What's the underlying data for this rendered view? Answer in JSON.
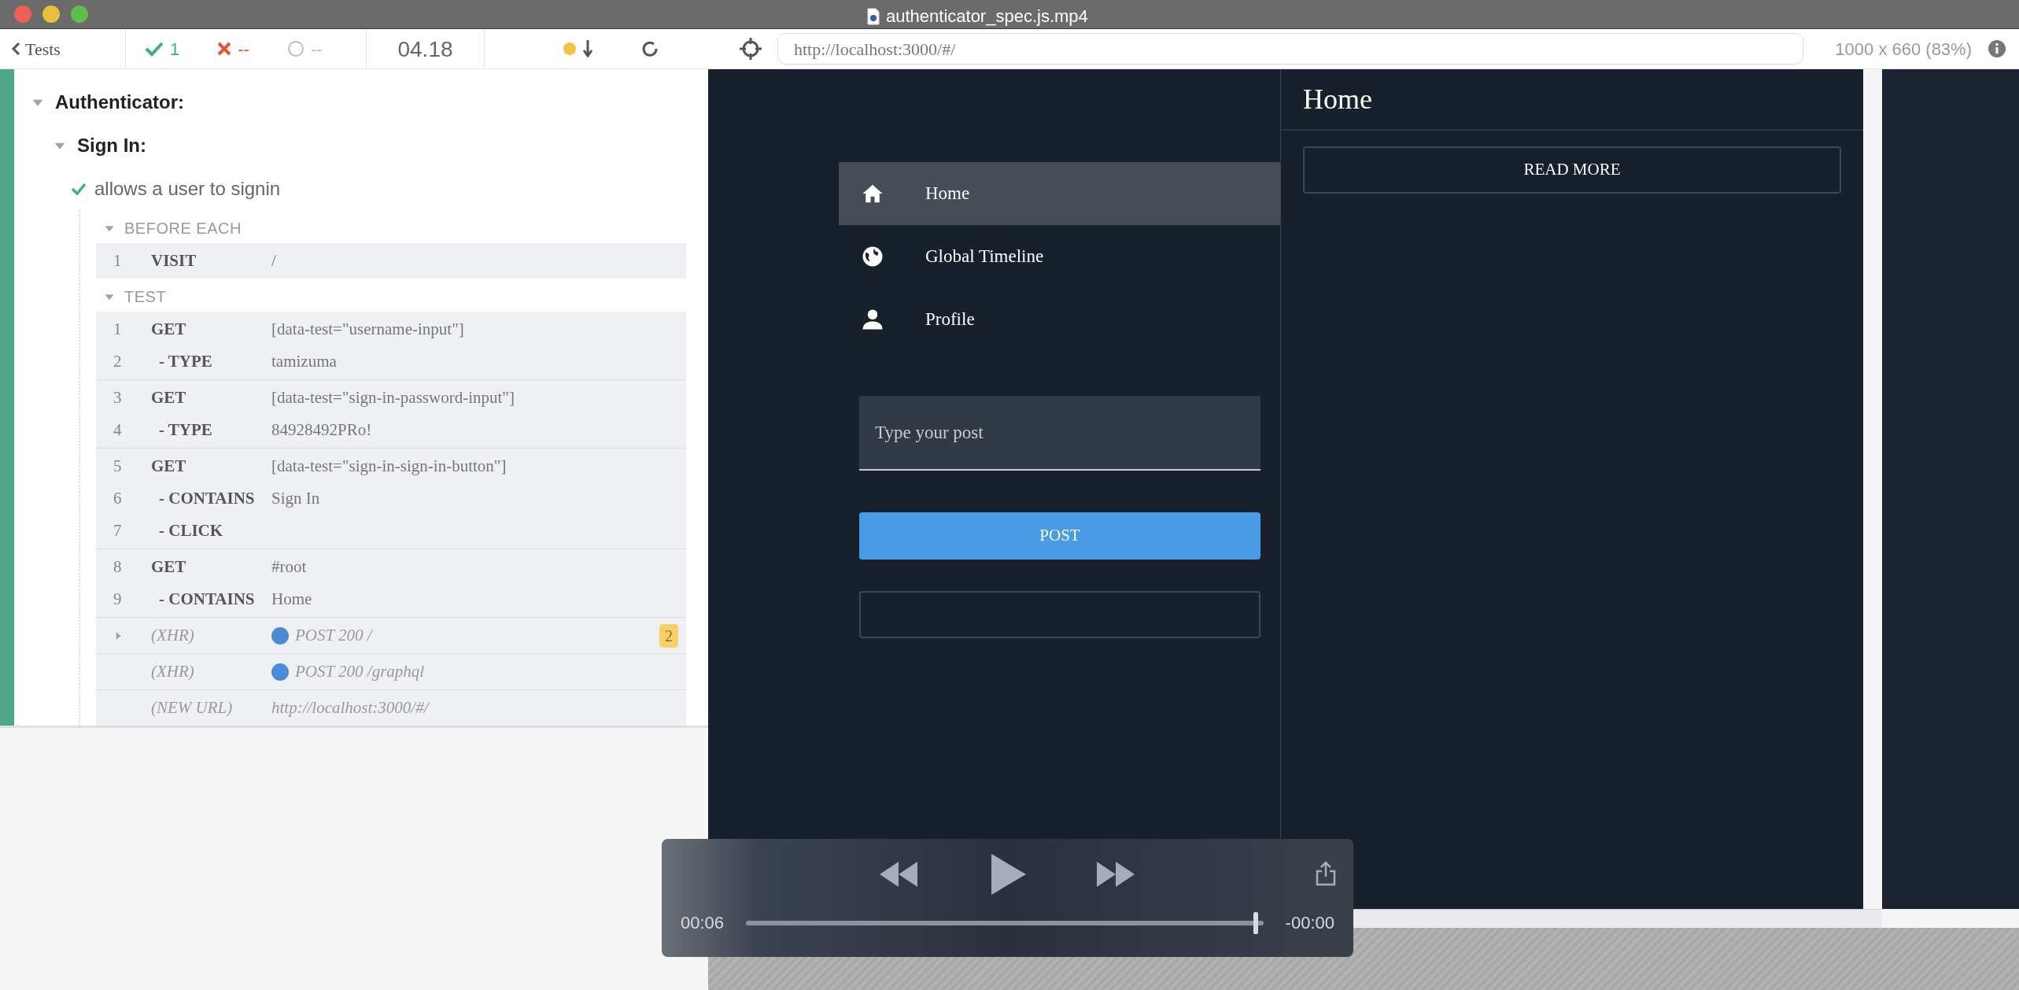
{
  "window": {
    "title": "authenticator_spec.js.mp4"
  },
  "toolbar": {
    "back_label": "Tests",
    "passed": "1",
    "failed": "--",
    "pending": "--",
    "duration": "04.18",
    "url": "http://localhost:3000/#/",
    "viewport": "1000 x 660 (83%)"
  },
  "suite": {
    "title": "Authenticator:",
    "expanded": true,
    "children": [
      {
        "title": "Sign In:",
        "expanded": true,
        "children": [
          {
            "title": "allows a user to signin",
            "passed": true,
            "hooks": [
              {
                "title": "BEFORE EACH",
                "groups": [
                  [
                    {
                      "kind": "command",
                      "number": "1",
                      "name": "VISIT",
                      "message": "/"
                    }
                  ]
                ]
              },
              {
                "title": "TEST",
                "groups": [
                  [
                    {
                      "kind": "command",
                      "number": "1",
                      "name": "GET",
                      "message": "[data-test=\"username-input\"]"
                    },
                    {
                      "kind": "child",
                      "number": "2",
                      "name": "- TYPE",
                      "message": "tamizuma"
                    }
                  ],
                  [
                    {
                      "kind": "command",
                      "number": "3",
                      "name": "GET",
                      "message": "[data-test=\"sign-in-password-input\"]"
                    },
                    {
                      "kind": "child",
                      "number": "4",
                      "name": "- TYPE",
                      "message": "84928492PRo!"
                    }
                  ],
                  [
                    {
                      "kind": "command",
                      "number": "5",
                      "name": "GET",
                      "message": "[data-test=\"sign-in-sign-in-button\"]"
                    },
                    {
                      "kind": "child",
                      "number": "6",
                      "name": "- CONTAINS",
                      "message": "Sign In"
                    },
                    {
                      "kind": "child",
                      "number": "7",
                      "name": "- CLICK"
                    }
                  ],
                  [
                    {
                      "kind": "command",
                      "number": "8",
                      "name": "GET",
                      "message": "#root"
                    },
                    {
                      "kind": "child",
                      "number": "9",
                      "name": "- CONTAINS",
                      "message": "Home"
                    }
                  ],
                  [
                    {
                      "kind": "event",
                      "name": "(XHR)",
                      "message": "POST 200 /",
                      "color": "#4a8bd6",
                      "expandable": true,
                      "badge": "2"
                    }
                  ],
                  [
                    {
                      "kind": "event",
                      "name": "(XHR)",
                      "message": "POST 200 /graphql",
                      "color": "#4a8bd6",
                      "expandable": false
                    }
                  ],
                  [
                    {
                      "kind": "event",
                      "name": "(NEW URL)",
                      "message": "http://localhost:3000/#/",
                      "expandable": false
                    }
                  ]
                ]
              }
            ]
          }
        ]
      }
    ]
  },
  "app": {
    "nav": [
      {
        "label": "Home",
        "selected": true
      },
      {
        "label": "Global Timeline",
        "selected": false
      },
      {
        "label": "Profile",
        "selected": false
      }
    ],
    "post_field": {
      "placeholder": "Type your post"
    },
    "post_button": "POST",
    "header": "Home",
    "read_more": "READ MORE"
  },
  "player": {
    "elapsed": "00:06",
    "remaining": "-00:00",
    "level": 0.985
  }
}
